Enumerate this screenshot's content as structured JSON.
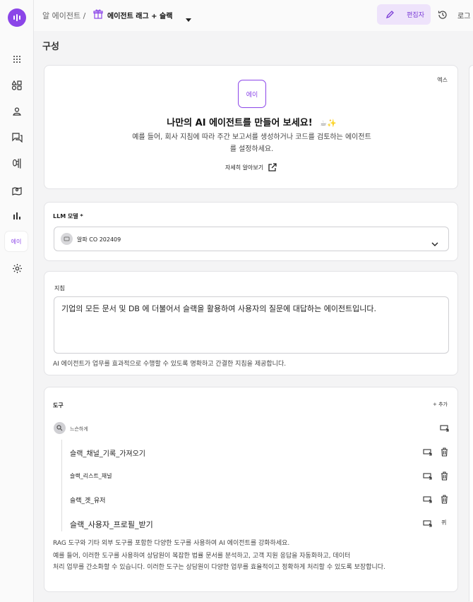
{
  "breadcrumb": {
    "root": "알 에이전트 /",
    "current": "에이전트 래그 + 슬랙"
  },
  "topbar": {
    "editor_label": "편집자",
    "right_cut": "로그"
  },
  "sidebar": {
    "active_label": "에이",
    "example_label": "예"
  },
  "page": {
    "title": "구성"
  },
  "intro": {
    "corner": "엑스",
    "avatar": "에이",
    "heading": "나만의 AI 에이전트를 만들어 보세요!",
    "desc_line1": "예를 들어, 회사 지침에 따라 주간 보고서를 생성하거나 코드를 검토하는 에이전트",
    "desc_line2": "를 설정하세요.",
    "learn_more": "자세히 알아보기"
  },
  "llm": {
    "label": "LLM 모델 *",
    "selected": "알파 CO 202409"
  },
  "instructions": {
    "label": "지침",
    "value": "기업의 모든 문서 및 DB 에 더불어서 슬랙을 활용하여 사용자의 질문에 대답하는 에이전트입니다.",
    "helper": "AI 에이전트가 업무를 효과적으로 수행할 수 있도록 명확하고 간결한 지침을 제공합니다."
  },
  "tools": {
    "label": "도구",
    "add": "+ 추가",
    "group": "느슨하게",
    "items": [
      "슬랙_채널_기록_가져오기",
      "슬랙_리스트_채널",
      "슬랙_겟_유저",
      "슬랙_사용자_프로필_받기"
    ],
    "last_action": "퀴",
    "footer_line1": "RAG 도구와 기타 외부 도구를 포함한 다양한 도구를 사용하여 AI 에이전트를 강화하세요.",
    "footer_line2": "예를 들어, 이러한 도구를 사용하여 상담원이 복잡한 법률 문서를 분석하고, 고객 지원 응답을 자동화하고, 데이터",
    "footer_line3": "처리 업무를 간소화할 수 있습니다. 이러한 도구는 상담원이 다양한 업무를 효율적이고 정확하게 처리할 수 있도록 보장합니다."
  }
}
